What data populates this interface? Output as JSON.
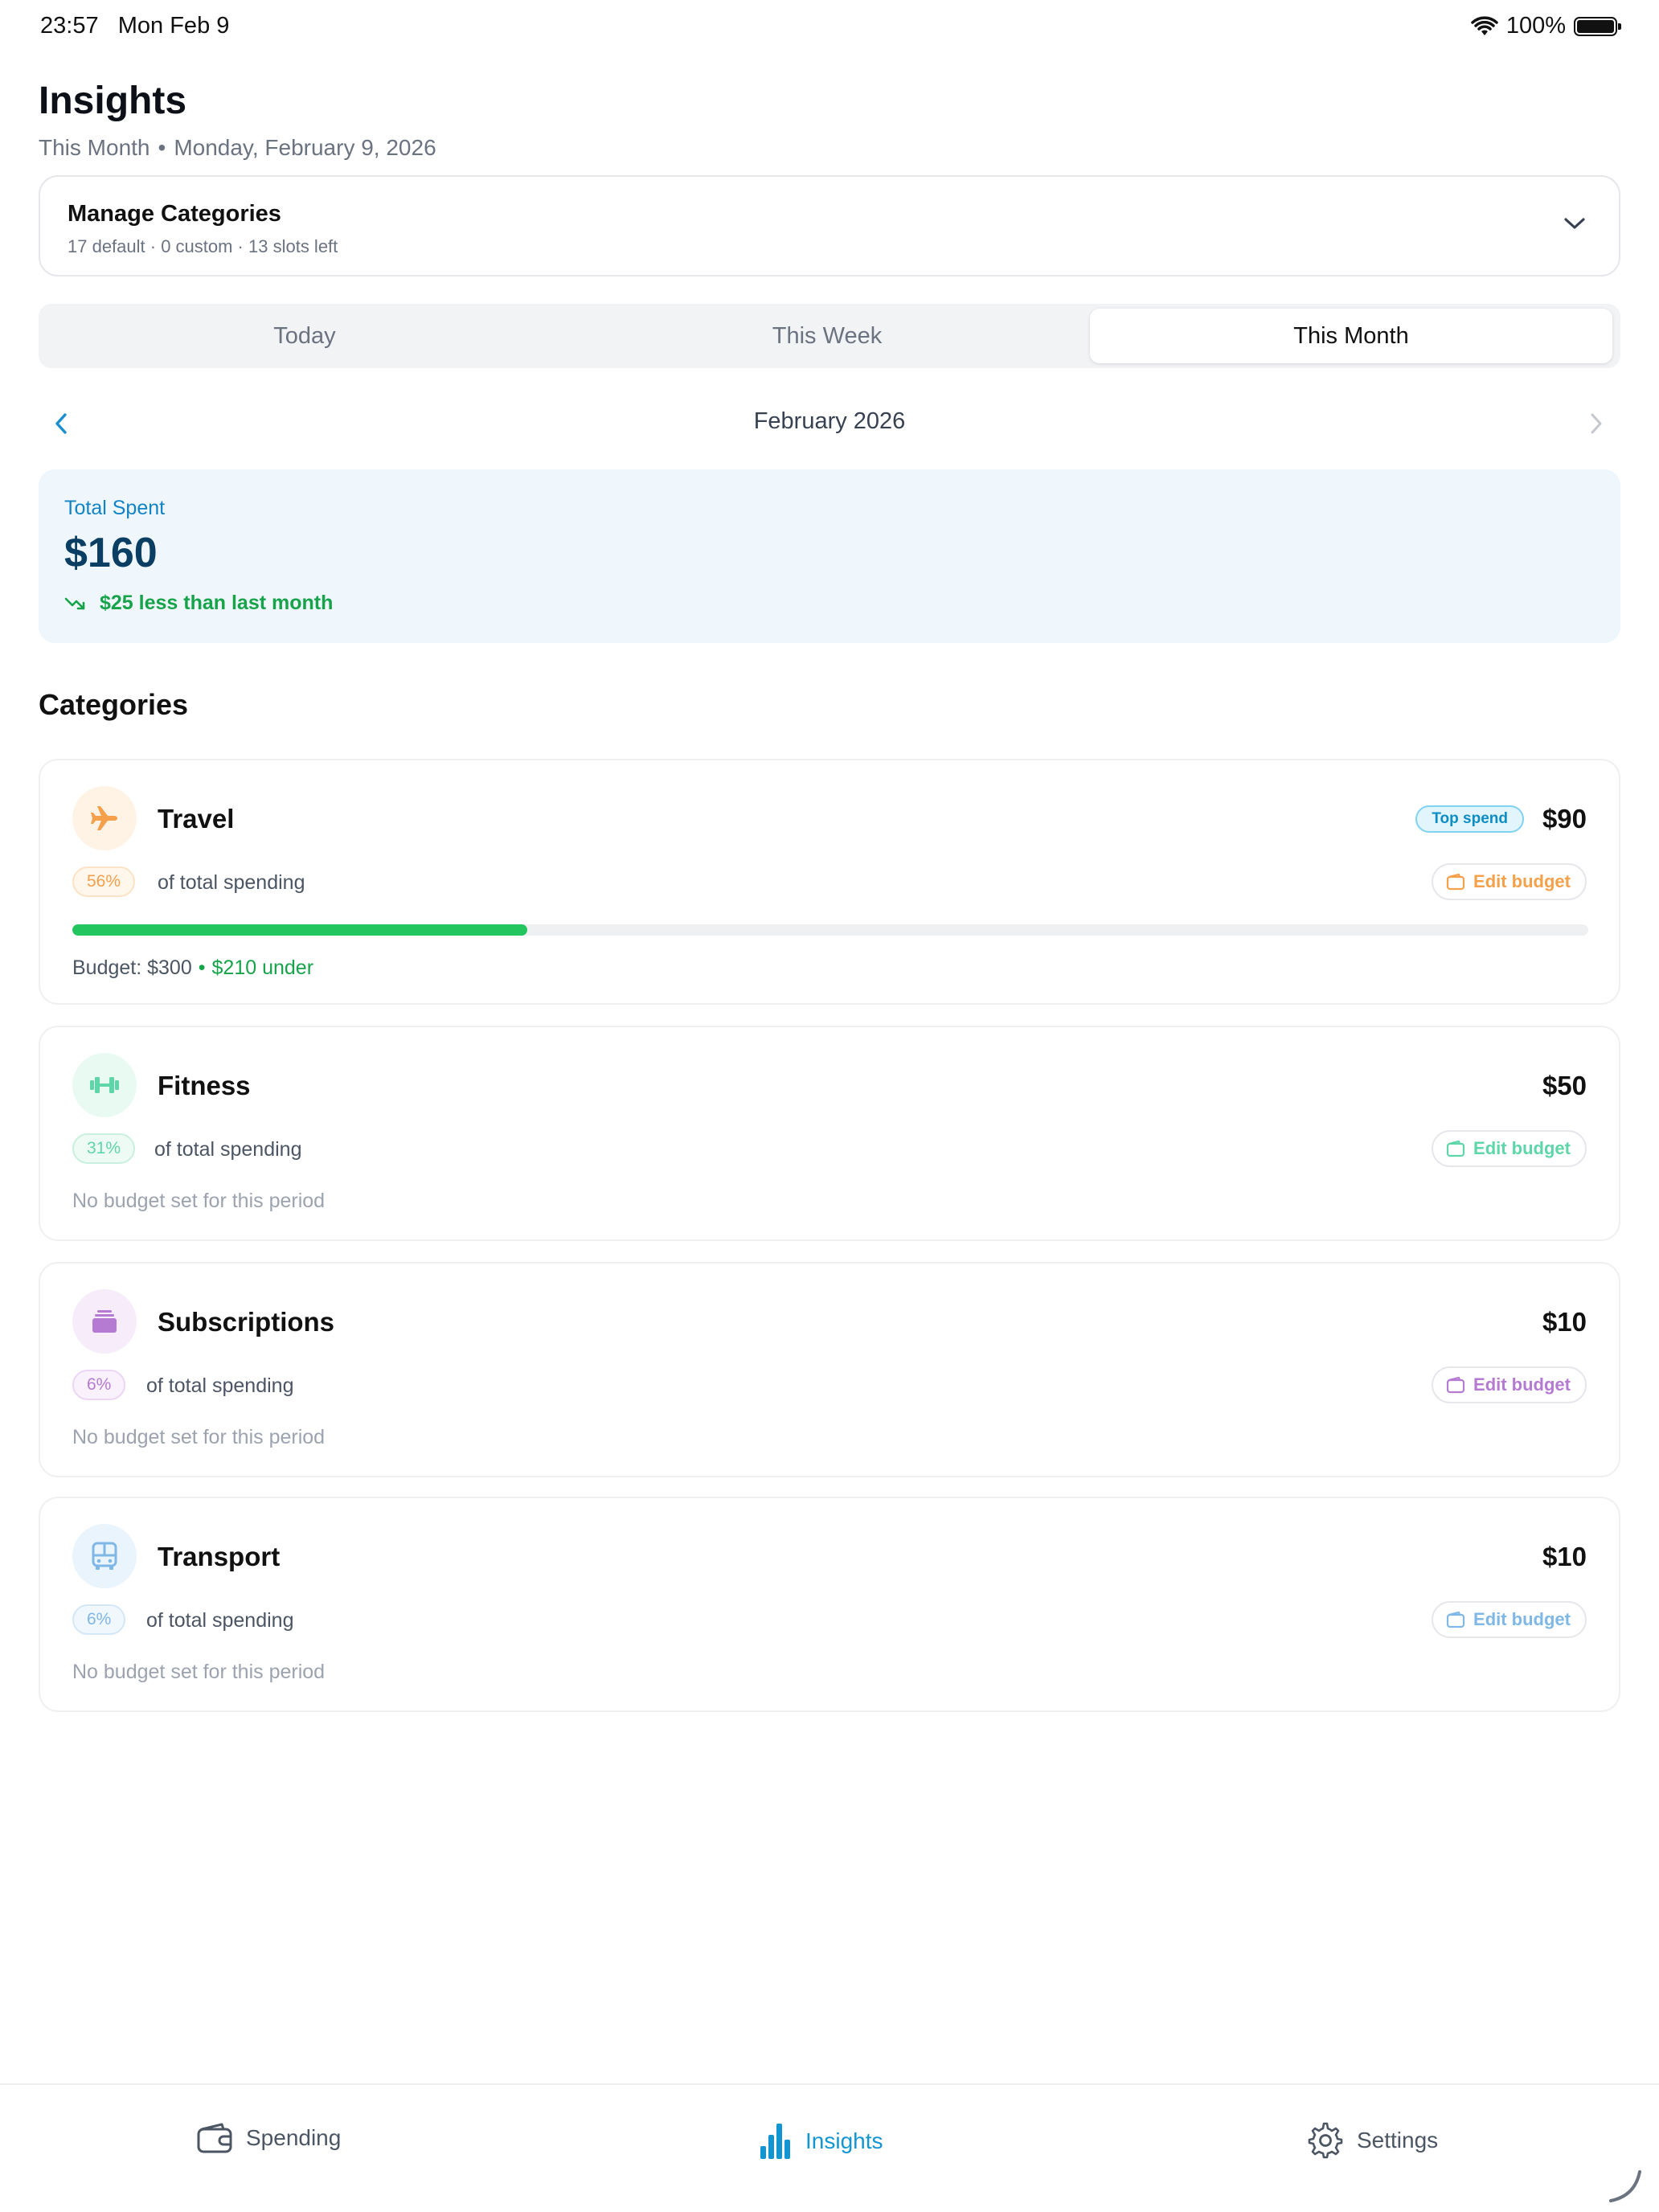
{
  "status": {
    "time": "23:57",
    "date": "Mon Feb 9",
    "battery": "100%"
  },
  "header": {
    "title": "Insights",
    "period": "This Month",
    "date": "Monday, February 9, 2026"
  },
  "manage": {
    "title": "Manage Categories",
    "subtitle": "17 default · 0 custom · 13 slots left"
  },
  "segments": [
    {
      "label": "Today"
    },
    {
      "label": "This Week"
    },
    {
      "label": "This Month",
      "selected": true
    }
  ],
  "month": {
    "label": "February 2026"
  },
  "total": {
    "label": "Total Spent",
    "value": "$160",
    "delta": "$25 less than last month"
  },
  "categories_title": "Categories",
  "categories": [
    {
      "name": "Travel",
      "amount": "$90",
      "badge": "Top spend",
      "pct": "56%",
      "pct_text": "of total spending",
      "edit_label": "Edit budget",
      "budget": "Budget: $300",
      "under": "$210 under",
      "progress": 0.3,
      "color": "#f5a04a",
      "bg": "#fff3e6",
      "icon": "airplane-icon"
    },
    {
      "name": "Fitness",
      "amount": "$50",
      "pct": "31%",
      "pct_text": "of total spending",
      "edit_label": "Edit budget",
      "no_budget": "No budget set for this period",
      "color": "#5ed6a9",
      "bg": "#e9faf3",
      "icon": "dumbbell-icon"
    },
    {
      "name": "Subscriptions",
      "amount": "$10",
      "pct": "6%",
      "pct_text": "of total spending",
      "edit_label": "Edit budget",
      "no_budget": "No budget set for this period",
      "color": "#b57ad1",
      "bg": "#f6ecfa",
      "icon": "stack-icon"
    },
    {
      "name": "Transport",
      "amount": "$10",
      "pct": "6%",
      "pct_text": "of total spending",
      "edit_label": "Edit budget",
      "no_budget": "No budget set for this period",
      "color": "#7fb8e6",
      "bg": "#eaf4fc",
      "icon": "bus-icon"
    }
  ],
  "tabs": [
    {
      "label": "Spending",
      "icon": "wallet-icon"
    },
    {
      "label": "Insights",
      "icon": "bar-chart-icon",
      "selected": true
    },
    {
      "label": "Settings",
      "icon": "gear-icon"
    }
  ]
}
